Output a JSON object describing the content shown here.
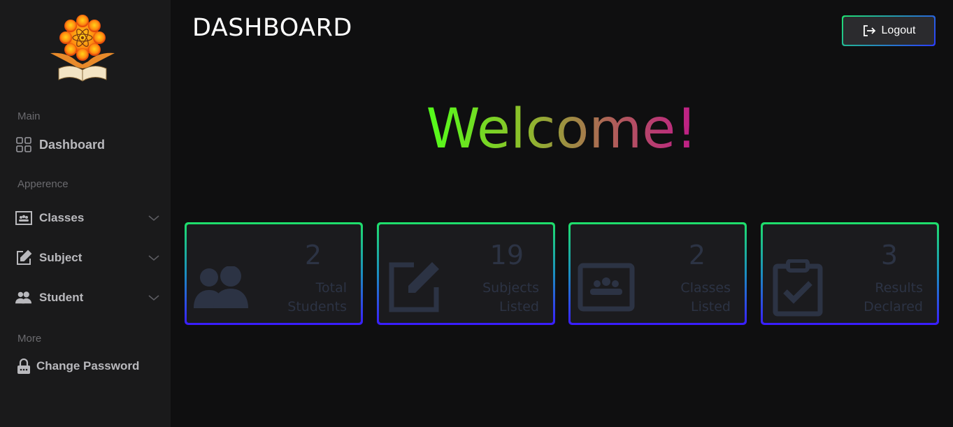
{
  "sidebar": {
    "sections": {
      "main": "Main",
      "appearance": "Apperence",
      "more": "More"
    },
    "items": [
      {
        "label": "Dashboard",
        "icon": "grid-icon"
      },
      {
        "label": "Classes",
        "icon": "classroom-icon"
      },
      {
        "label": "Subject",
        "icon": "edit-icon"
      },
      {
        "label": "Student",
        "icon": "users-icon"
      },
      {
        "label": "Change Password",
        "icon": "lock-icon"
      }
    ]
  },
  "header": {
    "title": "DASHBOARD",
    "logout_label": "Logout"
  },
  "welcome": "Welcome!",
  "cards": [
    {
      "value": "2",
      "line1": "Total",
      "line2": "Students",
      "icon": "users-icon"
    },
    {
      "value": "19",
      "line1": "Subjects",
      "line2": "Listed",
      "icon": "edit-icon"
    },
    {
      "value": "2",
      "line1": "Classes",
      "line2": "Listed",
      "icon": "classroom-icon"
    },
    {
      "value": "3",
      "line1": "Results",
      "line2": "Declared",
      "icon": "clipboard-check-icon"
    }
  ],
  "colors": {
    "accent_green": "#1ee06a",
    "accent_blue": "#3a1cff",
    "sidebar_bg": "#1a1a1b",
    "main_bg": "#0f0f10"
  }
}
